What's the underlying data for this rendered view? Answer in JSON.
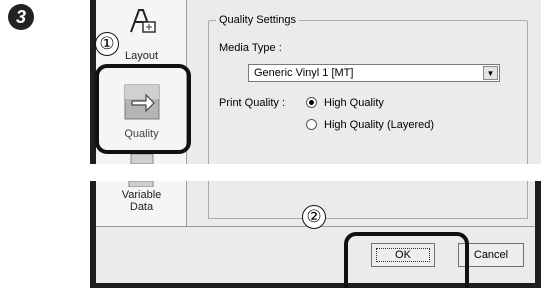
{
  "step_number": "3",
  "sidebar": {
    "layout_label": "Layout",
    "quality_label": "Quality",
    "variable_data_label": "Variable\nData"
  },
  "quality_settings": {
    "group_title": "Quality Settings",
    "media_type_label": "Media Type :",
    "media_type_value": "Generic Vinyl 1 [MT]",
    "print_quality_label": "Print Quality :",
    "options": [
      {
        "label": "High Quality",
        "selected": true
      },
      {
        "label": "High Quality (Layered)",
        "selected": false
      }
    ]
  },
  "buttons": {
    "ok_label": "OK",
    "cancel_label": "Cancel"
  },
  "callouts": {
    "first": "①",
    "second": "②"
  }
}
